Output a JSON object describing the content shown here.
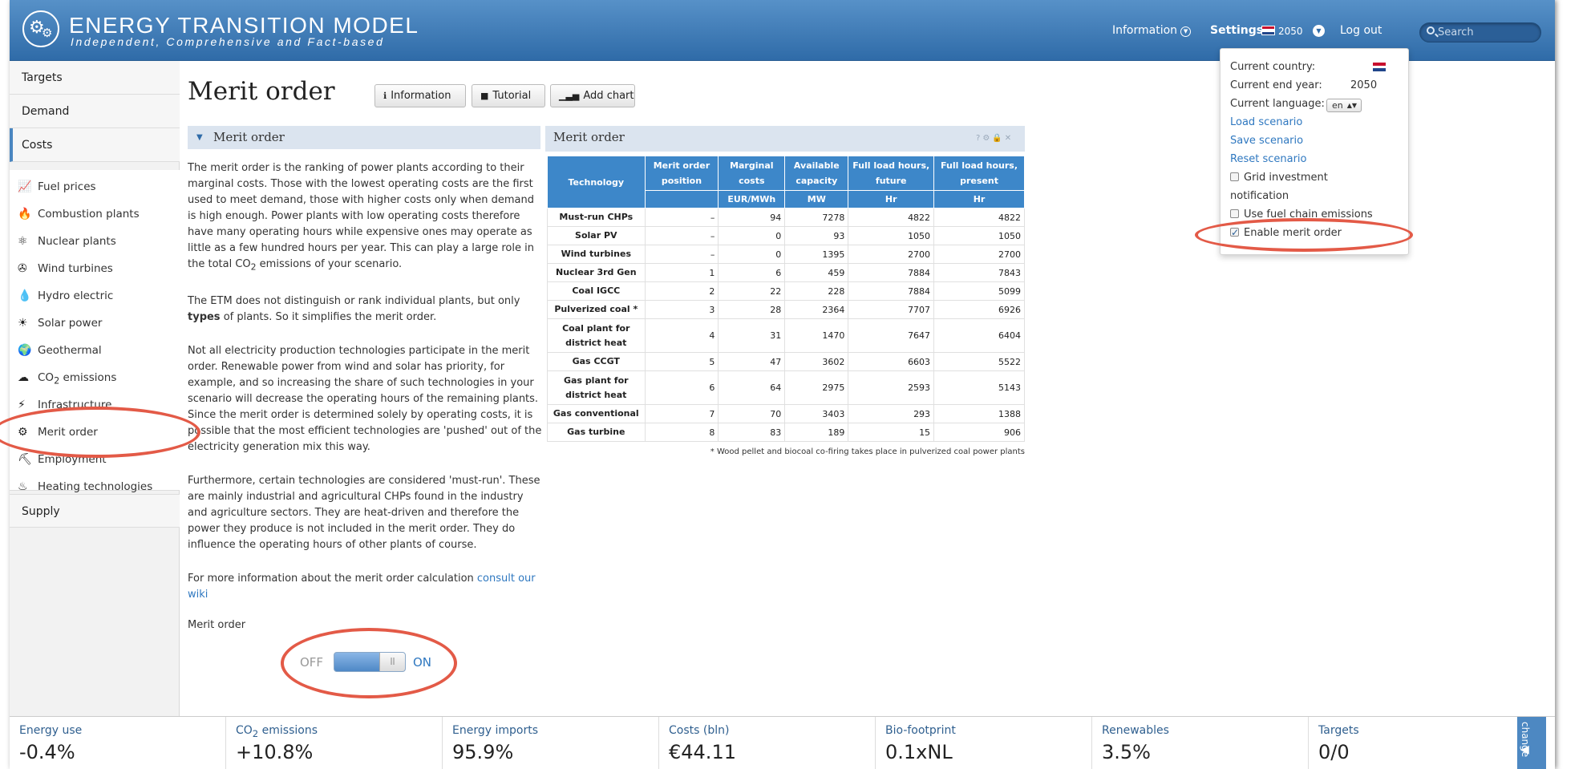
{
  "header": {
    "brand_title": "ENERGY TRANSITION MODEL",
    "brand_tagline": "Independent, Comprehensive and Fact-based",
    "nav_information": "Information",
    "nav_settings": "Settings",
    "nav_year": "2050",
    "nav_logout": "Log out",
    "search_placeholder": "Search"
  },
  "sidebar": {
    "sections": {
      "targets": "Targets",
      "demand": "Demand",
      "costs": "Costs",
      "supply": "Supply"
    },
    "items": [
      {
        "label": "Fuel prices",
        "icon": "chart-line-icon"
      },
      {
        "label": "Combustion plants",
        "icon": "flame-icon"
      },
      {
        "label": "Nuclear plants",
        "icon": "atom-icon"
      },
      {
        "label": "Wind turbines",
        "icon": "wind-turbine-icon"
      },
      {
        "label": "Hydro electric",
        "icon": "water-drop-icon"
      },
      {
        "label": "Solar power",
        "icon": "sun-icon"
      },
      {
        "label": "Geothermal",
        "icon": "globe-icon"
      },
      {
        "label": "CO",
        "sub": "2",
        "label_suffix": " emissions",
        "icon": "cloud-icon"
      },
      {
        "label": "Infrastructure",
        "icon": "pylon-icon"
      },
      {
        "label": "Merit order",
        "icon": "merit-order-icon"
      },
      {
        "label": "Employment",
        "icon": "worker-icon"
      },
      {
        "label": "Heating technologies",
        "icon": "heating-icon"
      }
    ]
  },
  "main": {
    "title": "Merit order",
    "buttons": {
      "information": "Information",
      "tutorial": "Tutorial",
      "add_chart": "Add chart"
    },
    "section_title": "Merit order",
    "paragraphs": [
      "The merit order is the ranking of power plants according to their marginal costs. Those with the lowest operating costs are the first used to meet demand, those with higher costs only when demand is high enough. Power plants with low operating costs therefore have many operating hours while expensive ones may operate as little as a few hundred hours per year. This can play a large role in the total",
      "CO",
      "2",
      " emissions of your scenario.",
      "The ETM does not distinguish or rank individual plants, but only",
      "types",
      " of plants. So it simplifies the merit order.",
      "Not all electricity production technologies participate in the merit order. Renewable power from wind and solar has priority, for example, and so increasing the share of such technologies in your scenario will decrease the operating hours of the remaining plants. Since the merit order is determined solely by operating costs, it is possible that the most efficient technologies are 'pushed' out of the electricity generation mix this way.",
      "Furthermore, certain technologies are considered 'must-run'. These are mainly industrial and agricultural CHPs found in the industry and agriculture sectors. They are heat-driven and therefore the power they produce is not included in the merit order. They do influence the operating hours of other plants of course.",
      "For more information about the merit order calculation ",
      "consult our wiki"
    ],
    "toggle": {
      "label": "Merit order",
      "off": "OFF",
      "on": "ON",
      "knob": "||",
      "state": "on"
    }
  },
  "chart_panel": {
    "title": "Merit order",
    "columns": [
      "Technology",
      "Merit order position",
      "Marginal costs",
      "Available capacity",
      "Full load hours, future",
      "Full load hours, present"
    ],
    "units": [
      "",
      "",
      "EUR/MWh",
      "MW",
      "Hr",
      "Hr"
    ],
    "rows": [
      [
        "Must-run CHPs",
        "–",
        "94",
        "7278",
        "4822",
        "4822"
      ],
      [
        "Solar PV",
        "–",
        "0",
        "93",
        "1050",
        "1050"
      ],
      [
        "Wind turbines",
        "–",
        "0",
        "1395",
        "2700",
        "2700"
      ],
      [
        "Nuclear 3rd Gen",
        "1",
        "6",
        "459",
        "7884",
        "7843"
      ],
      [
        "Coal IGCC",
        "2",
        "22",
        "228",
        "7884",
        "5099"
      ],
      [
        "Pulverized coal *",
        "3",
        "28",
        "2364",
        "7707",
        "6926"
      ],
      [
        "Coal plant for district heat",
        "4",
        "31",
        "1470",
        "7647",
        "6404"
      ],
      [
        "Gas CCGT",
        "5",
        "47",
        "3602",
        "6603",
        "5522"
      ],
      [
        "Gas plant for district heat",
        "6",
        "64",
        "2975",
        "2593",
        "5143"
      ],
      [
        "Gas conventional",
        "7",
        "70",
        "3403",
        "293",
        "1388"
      ],
      [
        "Gas turbine",
        "8",
        "83",
        "189",
        "15",
        "906"
      ]
    ],
    "note": "* Wood pellet and biocoal co-firing takes place in pulverized coal power plants"
  },
  "settings_menu": {
    "current_country": "Current country:",
    "current_end_year": "Current end year:",
    "end_year_value": "2050",
    "current_language": "Current language:",
    "language_value": "en",
    "load_scenario": "Load scenario",
    "save_scenario": "Save scenario",
    "reset_scenario": "Reset scenario",
    "grid_investment_a": "Grid investment",
    "grid_investment_b": "notification",
    "use_fuel_chain": "Use fuel chain emissions",
    "enable_merit_order": "Enable merit order",
    "grid_investment_checked": false,
    "use_fuel_chain_checked": false,
    "enable_merit_order_checked": true
  },
  "dashboard": [
    {
      "label": "Energy use",
      "value": "-0.4%"
    },
    {
      "label": "CO",
      "sub": "2",
      "label_suffix": " emissions",
      "value": "+10.8%"
    },
    {
      "label": "Energy imports",
      "value": "95.9%"
    },
    {
      "label": "Costs (bln)",
      "value": "€44.11"
    },
    {
      "label": "Bio-footprint",
      "value": "0.1xNL"
    },
    {
      "label": "Renewables",
      "value": "3.5%"
    },
    {
      "label": "Targets",
      "value": "0/0"
    }
  ],
  "dashboard_change": "change",
  "colors": {
    "header": "#3f7cba",
    "accent": "#2f78c0",
    "table_header": "#3d87c9",
    "annotation": "#e35a47"
  }
}
